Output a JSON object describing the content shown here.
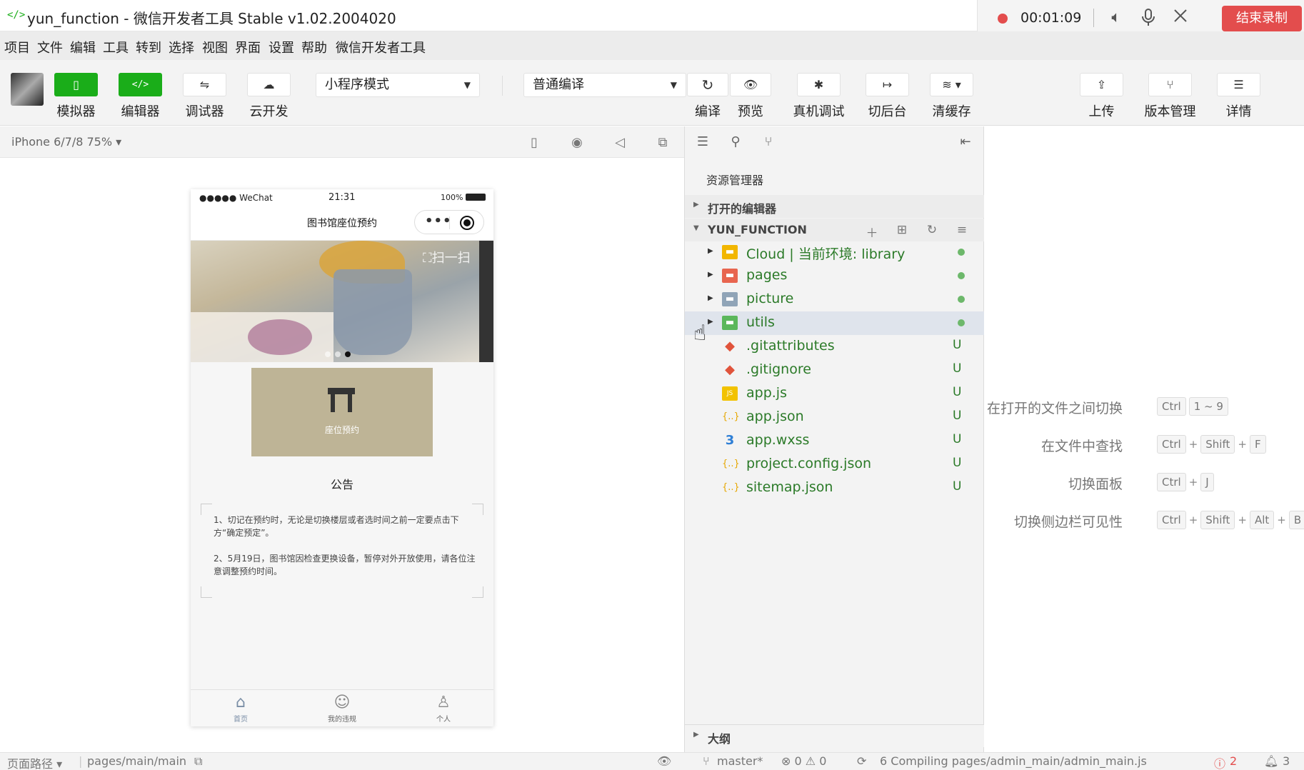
{
  "window": {
    "title": "yun_function - 微信开发者工具 Stable v1.02.2004020"
  },
  "recording": {
    "timer": "00:01:09",
    "stop_label": "结束录制"
  },
  "menubar": {
    "items": [
      "项目",
      "文件",
      "编辑",
      "工具",
      "转到",
      "选择",
      "视图",
      "界面",
      "设置",
      "帮助",
      "微信开发者工具"
    ]
  },
  "toolbar": {
    "simulator": "模拟器",
    "editor": "编辑器",
    "debugger": "调试器",
    "cloud": "云开发",
    "mode_select": "小程序模式",
    "compile_select": "普通编译",
    "compile": "编译",
    "preview": "预览",
    "remote_debug": "真机调试",
    "background": "切后台",
    "clear_cache": "清缓存",
    "upload": "上传",
    "version": "版本管理",
    "details": "详情"
  },
  "simulator": {
    "device": "iPhone 6/7/8 75% ▾",
    "status": {
      "carrier": "●●●●● WeChat",
      "time": "21:31",
      "battery": "100%"
    },
    "nav_title": "图书馆座位预约",
    "scan_label": "扫一扫",
    "card_label": "座位预约",
    "notice_title": "公告",
    "notices": [
      "1、切记在预约时，无论是切换楼层或者选时间之前一定要点击下方“确定预定”。",
      "2、5月19日，图书馆因检查更换设备，暂停对外开放使用，请各位注意调整预约时间。"
    ],
    "tabs": [
      "首页",
      "我的违规",
      "个人"
    ]
  },
  "explorer": {
    "title": "资源管理器",
    "open_editors": "打开的编辑器",
    "project": "YUN_FUNCTION",
    "outline": "大纲",
    "files": [
      {
        "name": "Cloud | 当前环境: library",
        "status": "dot",
        "type": "folder",
        "color": "#f2b600"
      },
      {
        "name": "pages",
        "status": "dot",
        "type": "folder",
        "color": "#e8654f"
      },
      {
        "name": "picture",
        "status": "dot",
        "type": "folder",
        "color": "#90a4b7"
      },
      {
        "name": "utils",
        "status": "dot",
        "type": "folder",
        "color": "#5bb75b"
      },
      {
        "name": ".gitattributes",
        "status": "U",
        "type": "git",
        "color": "#e0533b"
      },
      {
        "name": ".gitignore",
        "status": "U",
        "type": "git",
        "color": "#e0533b"
      },
      {
        "name": "app.js",
        "status": "U",
        "type": "js",
        "color": "#f2c200"
      },
      {
        "name": "app.json",
        "status": "U",
        "type": "json",
        "color": "#e6a700"
      },
      {
        "name": "app.wxss",
        "status": "U",
        "type": "css",
        "color": "#2e7fd6"
      },
      {
        "name": "project.config.json",
        "status": "U",
        "type": "json",
        "color": "#e6a700"
      },
      {
        "name": "sitemap.json",
        "status": "U",
        "type": "json",
        "color": "#e6a700"
      }
    ]
  },
  "shortcuts": [
    {
      "label": "在打开的文件之间切换",
      "keys": [
        "Ctrl",
        "1 ~ 9"
      ],
      "joiners": [
        ""
      ]
    },
    {
      "label": "在文件中查找",
      "keys": [
        "Ctrl",
        "Shift",
        "F"
      ],
      "joiners": [
        "+",
        "+"
      ]
    },
    {
      "label": "切换面板",
      "keys": [
        "Ctrl",
        "J"
      ],
      "joiners": [
        "+"
      ]
    },
    {
      "label": "切换侧边栏可见性",
      "keys": [
        "Ctrl",
        "Shift",
        "Alt",
        "B"
      ],
      "joiners": [
        "+",
        "+",
        "+"
      ]
    }
  ],
  "statusbar": {
    "page_path_label": "页面路径 ▾",
    "page_path": "pages/main/main",
    "branch": "master*",
    "problems": "⊗ 0 ⚠ 0",
    "compiling": "6 Compiling pages/admin_main/admin_main.js",
    "errors": "2",
    "notifications": "3"
  },
  "colors": {
    "accent": "#1aad19",
    "record_red": "#e34d4d",
    "git_green": "#2b7a28"
  }
}
